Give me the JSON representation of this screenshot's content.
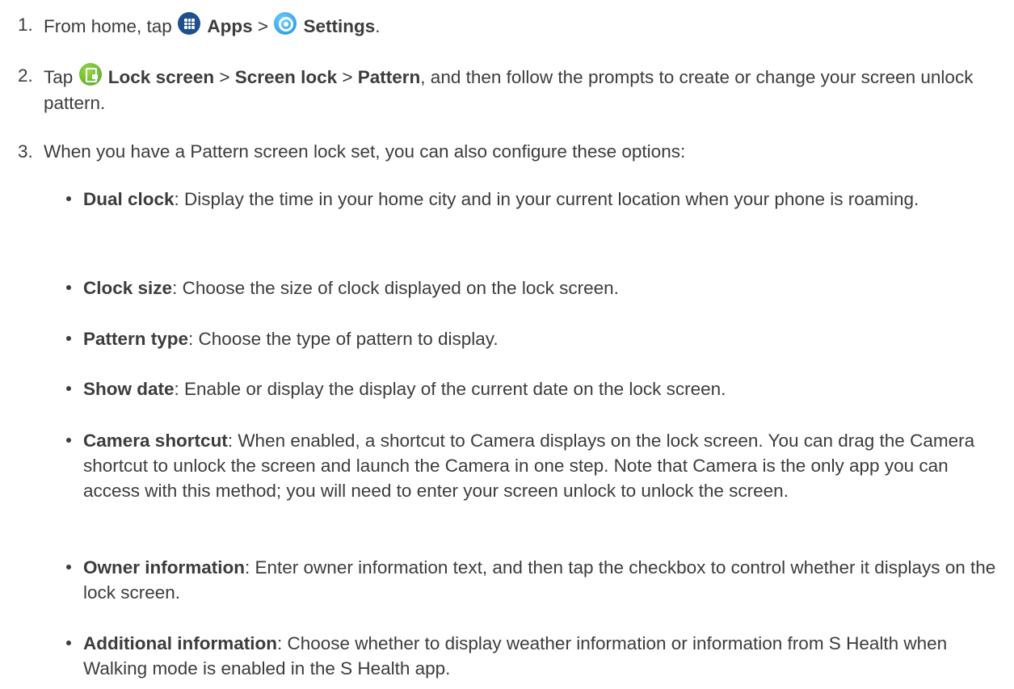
{
  "steps": [
    {
      "number": "1.",
      "text_a": "From home, tap ",
      "apps_label": "Apps",
      "sep": " > ",
      "settings_label": "Settings",
      "end": "."
    },
    {
      "number": "2.",
      "text_a": "Tap ",
      "lock_screen_label": "Lock screen",
      "sep1": " > ",
      "screen_lock_label": "Screen lock",
      "sep2": " > ",
      "pattern_label": "Pattern",
      "text_b": ", and then follow the prompts to create or change your screen unlock pattern."
    },
    {
      "number": "3.",
      "text": "When you have a Pattern screen lock set, you can also configure these options:"
    }
  ],
  "options": [
    {
      "term": "Dual clock",
      "desc": ": Display the time in your home city and in your current location when your phone is roaming."
    },
    {
      "term": "Clock size",
      "desc": ": Choose the size of clock displayed on the lock screen."
    },
    {
      "term": "Pattern type",
      "desc": ": Choose the type of pattern to display."
    },
    {
      "term": "Show date",
      "desc": ": Enable or display the display of the current date on the lock screen."
    },
    {
      "term": "Camera shortcut",
      "desc": ": When enabled, a shortcut to Camera displays on the lock screen. You can drag the Camera shortcut to unlock the screen and launch the Camera in one step. Note that Camera is the only app you can access with this method; you will need to enter your screen unlock to unlock the screen."
    },
    {
      "term": "Owner information",
      "desc": ": Enter owner information text, and then tap the checkbox to control whether it displays on the lock screen."
    },
    {
      "term": "Additional information",
      "desc": ": Choose whether to display weather information or information from S Health when Walking mode is enabled in the S Health app."
    }
  ],
  "icons": {
    "apps": "apps-grid-icon",
    "settings": "settings-gear-icon",
    "lock_screen": "lock-screen-icon"
  },
  "colors": {
    "text": "#3c3c3c",
    "apps_icon": "#1e4f8f",
    "settings_icon": "#1a8fe0",
    "lock_icon": "#4fa32a"
  }
}
